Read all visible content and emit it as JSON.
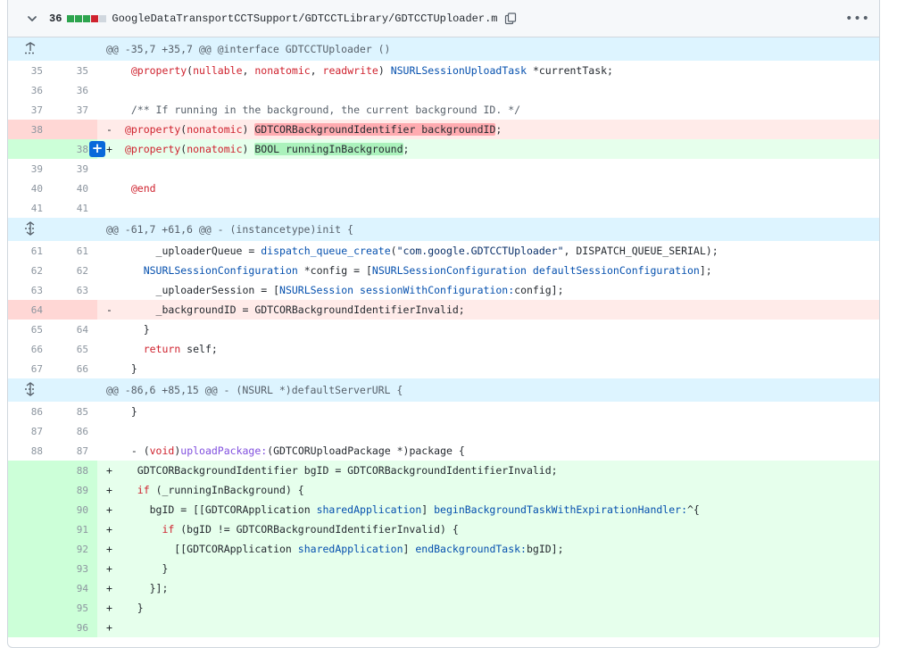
{
  "header": {
    "count": "36",
    "filename": "GoogleDataTransportCCTSupport/GDTCCTLibrary/GDTCCTUploader.m",
    "blocks": [
      "add",
      "add",
      "add",
      "del",
      "neutral"
    ],
    "colors": {
      "add": "#2da44e",
      "del": "#cf222e",
      "neutral": "#d0d7de"
    },
    "icons": {
      "collapse": "chevron-down-icon",
      "copy": "copy-icon",
      "menu": "kebab-horizontal-icon"
    }
  },
  "rows": [
    {
      "type": "hunk",
      "text": "@@ -35,7 +35,7 @@ @interface GDTCCTUploader ()",
      "icon": "expand-up-icon"
    },
    {
      "type": "ctx",
      "l": "35",
      "r": "35",
      "tokens": [
        [
          "  "
        ],
        [
          "@property",
          "kw"
        ],
        [
          "("
        ],
        [
          "nullable",
          "kw"
        ],
        [
          ", "
        ],
        [
          "nonatomic",
          "kw"
        ],
        [
          ", "
        ],
        [
          "readwrite",
          "kw"
        ],
        [
          ") "
        ],
        [
          "NSURLSessionUploadTask",
          "ty"
        ],
        [
          " *currentTask;"
        ]
      ]
    },
    {
      "type": "ctx",
      "l": "36",
      "r": "36",
      "tokens": []
    },
    {
      "type": "ctx",
      "l": "37",
      "r": "37",
      "tokens": [
        [
          "  "
        ],
        [
          "/** If running in the background, the current background ID. */",
          "cm"
        ]
      ]
    },
    {
      "type": "del",
      "l": "38",
      "r": "",
      "marker": "-",
      "tokens": [
        [
          " "
        ],
        [
          "@property",
          "kw"
        ],
        [
          "("
        ],
        [
          "nonatomic",
          "kw"
        ],
        [
          ") "
        ],
        [
          "GDTCORBackgroundIdentifier backgroundID",
          "xdel"
        ],
        [
          ";"
        ]
      ]
    },
    {
      "type": "add",
      "l": "",
      "r": "38",
      "marker": "+",
      "plus": true,
      "tokens": [
        [
          " "
        ],
        [
          "@property",
          "kw"
        ],
        [
          "("
        ],
        [
          "nonatomic",
          "kw"
        ],
        [
          ") "
        ],
        [
          "BOOL runningInBackground",
          "xadd"
        ],
        [
          ";"
        ]
      ]
    },
    {
      "type": "ctx",
      "l": "39",
      "r": "39",
      "tokens": []
    },
    {
      "type": "ctx",
      "l": "40",
      "r": "40",
      "tokens": [
        [
          "  "
        ],
        [
          "@end",
          "kw"
        ]
      ]
    },
    {
      "type": "ctx",
      "l": "41",
      "r": "41",
      "tokens": []
    },
    {
      "type": "hunk",
      "text": "@@ -61,7 +61,6 @@ - (instancetype)init {",
      "icon": "expand-both-icon"
    },
    {
      "type": "ctx",
      "l": "61",
      "r": "61",
      "tokens": [
        [
          "      _uploaderQueue = "
        ],
        [
          "dispatch_queue_create",
          "ty"
        ],
        [
          "("
        ],
        [
          "\"com.google.GDTCCTUploader\"",
          "st"
        ],
        [
          ", DISPATCH_QUEUE_SERIAL);"
        ]
      ]
    },
    {
      "type": "ctx",
      "l": "62",
      "r": "62",
      "tokens": [
        [
          "    "
        ],
        [
          "NSURLSessionConfiguration",
          "ty"
        ],
        [
          " *config = ["
        ],
        [
          "NSURLSessionConfiguration",
          "ty"
        ],
        [
          " "
        ],
        [
          "defaultSessionConfiguration",
          "ty"
        ],
        [
          "];"
        ]
      ]
    },
    {
      "type": "ctx",
      "l": "63",
      "r": "63",
      "tokens": [
        [
          "      _uploaderSession = ["
        ],
        [
          "NSURLSession",
          "ty"
        ],
        [
          " "
        ],
        [
          "sessionWithConfiguration:",
          "ty"
        ],
        [
          "config];"
        ]
      ]
    },
    {
      "type": "del",
      "l": "64",
      "r": "",
      "marker": "-",
      "tokens": [
        [
          "      _backgroundID = GDTCORBackgroundIdentifierInvalid;"
        ]
      ]
    },
    {
      "type": "ctx",
      "l": "65",
      "r": "64",
      "tokens": [
        [
          "    }"
        ]
      ]
    },
    {
      "type": "ctx",
      "l": "66",
      "r": "65",
      "tokens": [
        [
          "    "
        ],
        [
          "return",
          "kw"
        ],
        [
          " self;"
        ]
      ]
    },
    {
      "type": "ctx",
      "l": "67",
      "r": "66",
      "tokens": [
        [
          "  }"
        ]
      ]
    },
    {
      "type": "hunk",
      "text": "@@ -86,6 +85,15 @@ - (NSURL *)defaultServerURL {",
      "icon": "expand-both-icon"
    },
    {
      "type": "ctx",
      "l": "86",
      "r": "85",
      "tokens": [
        [
          "  }"
        ]
      ]
    },
    {
      "type": "ctx",
      "l": "87",
      "r": "86",
      "tokens": []
    },
    {
      "type": "ctx",
      "l": "88",
      "r": "87",
      "tokens": [
        [
          "  - ("
        ],
        [
          "void",
          "kw"
        ],
        [
          ")"
        ],
        [
          "uploadPackage:",
          "fn"
        ],
        [
          "(GDTCORUploadPackage *)package {"
        ]
      ]
    },
    {
      "type": "add",
      "l": "",
      "r": "88",
      "marker": "+",
      "tokens": [
        [
          "   GDTCORBackgroundIdentifier bgID = GDTCORBackgroundIdentifierInvalid;"
        ]
      ]
    },
    {
      "type": "add",
      "l": "",
      "r": "89",
      "marker": "+",
      "tokens": [
        [
          "   "
        ],
        [
          "if",
          "kw"
        ],
        [
          " (_runningInBackground) {"
        ]
      ]
    },
    {
      "type": "add",
      "l": "",
      "r": "90",
      "marker": "+",
      "tokens": [
        [
          "     bgID = [[GDTCORApplication "
        ],
        [
          "sharedApplication",
          "ty"
        ],
        [
          "] "
        ],
        [
          "beginBackgroundTaskWithExpirationHandler:",
          "ty"
        ],
        [
          "^{"
        ]
      ]
    },
    {
      "type": "add",
      "l": "",
      "r": "91",
      "marker": "+",
      "tokens": [
        [
          "       "
        ],
        [
          "if",
          "kw"
        ],
        [
          " (bgID != GDTCORBackgroundIdentifierInvalid) {"
        ]
      ]
    },
    {
      "type": "add",
      "l": "",
      "r": "92",
      "marker": "+",
      "tokens": [
        [
          "         [[GDTCORApplication "
        ],
        [
          "sharedApplication",
          "ty"
        ],
        [
          "] "
        ],
        [
          "endBackgroundTask:",
          "ty"
        ],
        [
          "bgID];"
        ]
      ]
    },
    {
      "type": "add",
      "l": "",
      "r": "93",
      "marker": "+",
      "tokens": [
        [
          "       }"
        ]
      ]
    },
    {
      "type": "add",
      "l": "",
      "r": "94",
      "marker": "+",
      "tokens": [
        [
          "     }];"
        ]
      ]
    },
    {
      "type": "add",
      "l": "",
      "r": "95",
      "marker": "+",
      "tokens": [
        [
          "   }"
        ]
      ]
    },
    {
      "type": "add",
      "l": "",
      "r": "96",
      "marker": "+",
      "tokens": []
    }
  ]
}
